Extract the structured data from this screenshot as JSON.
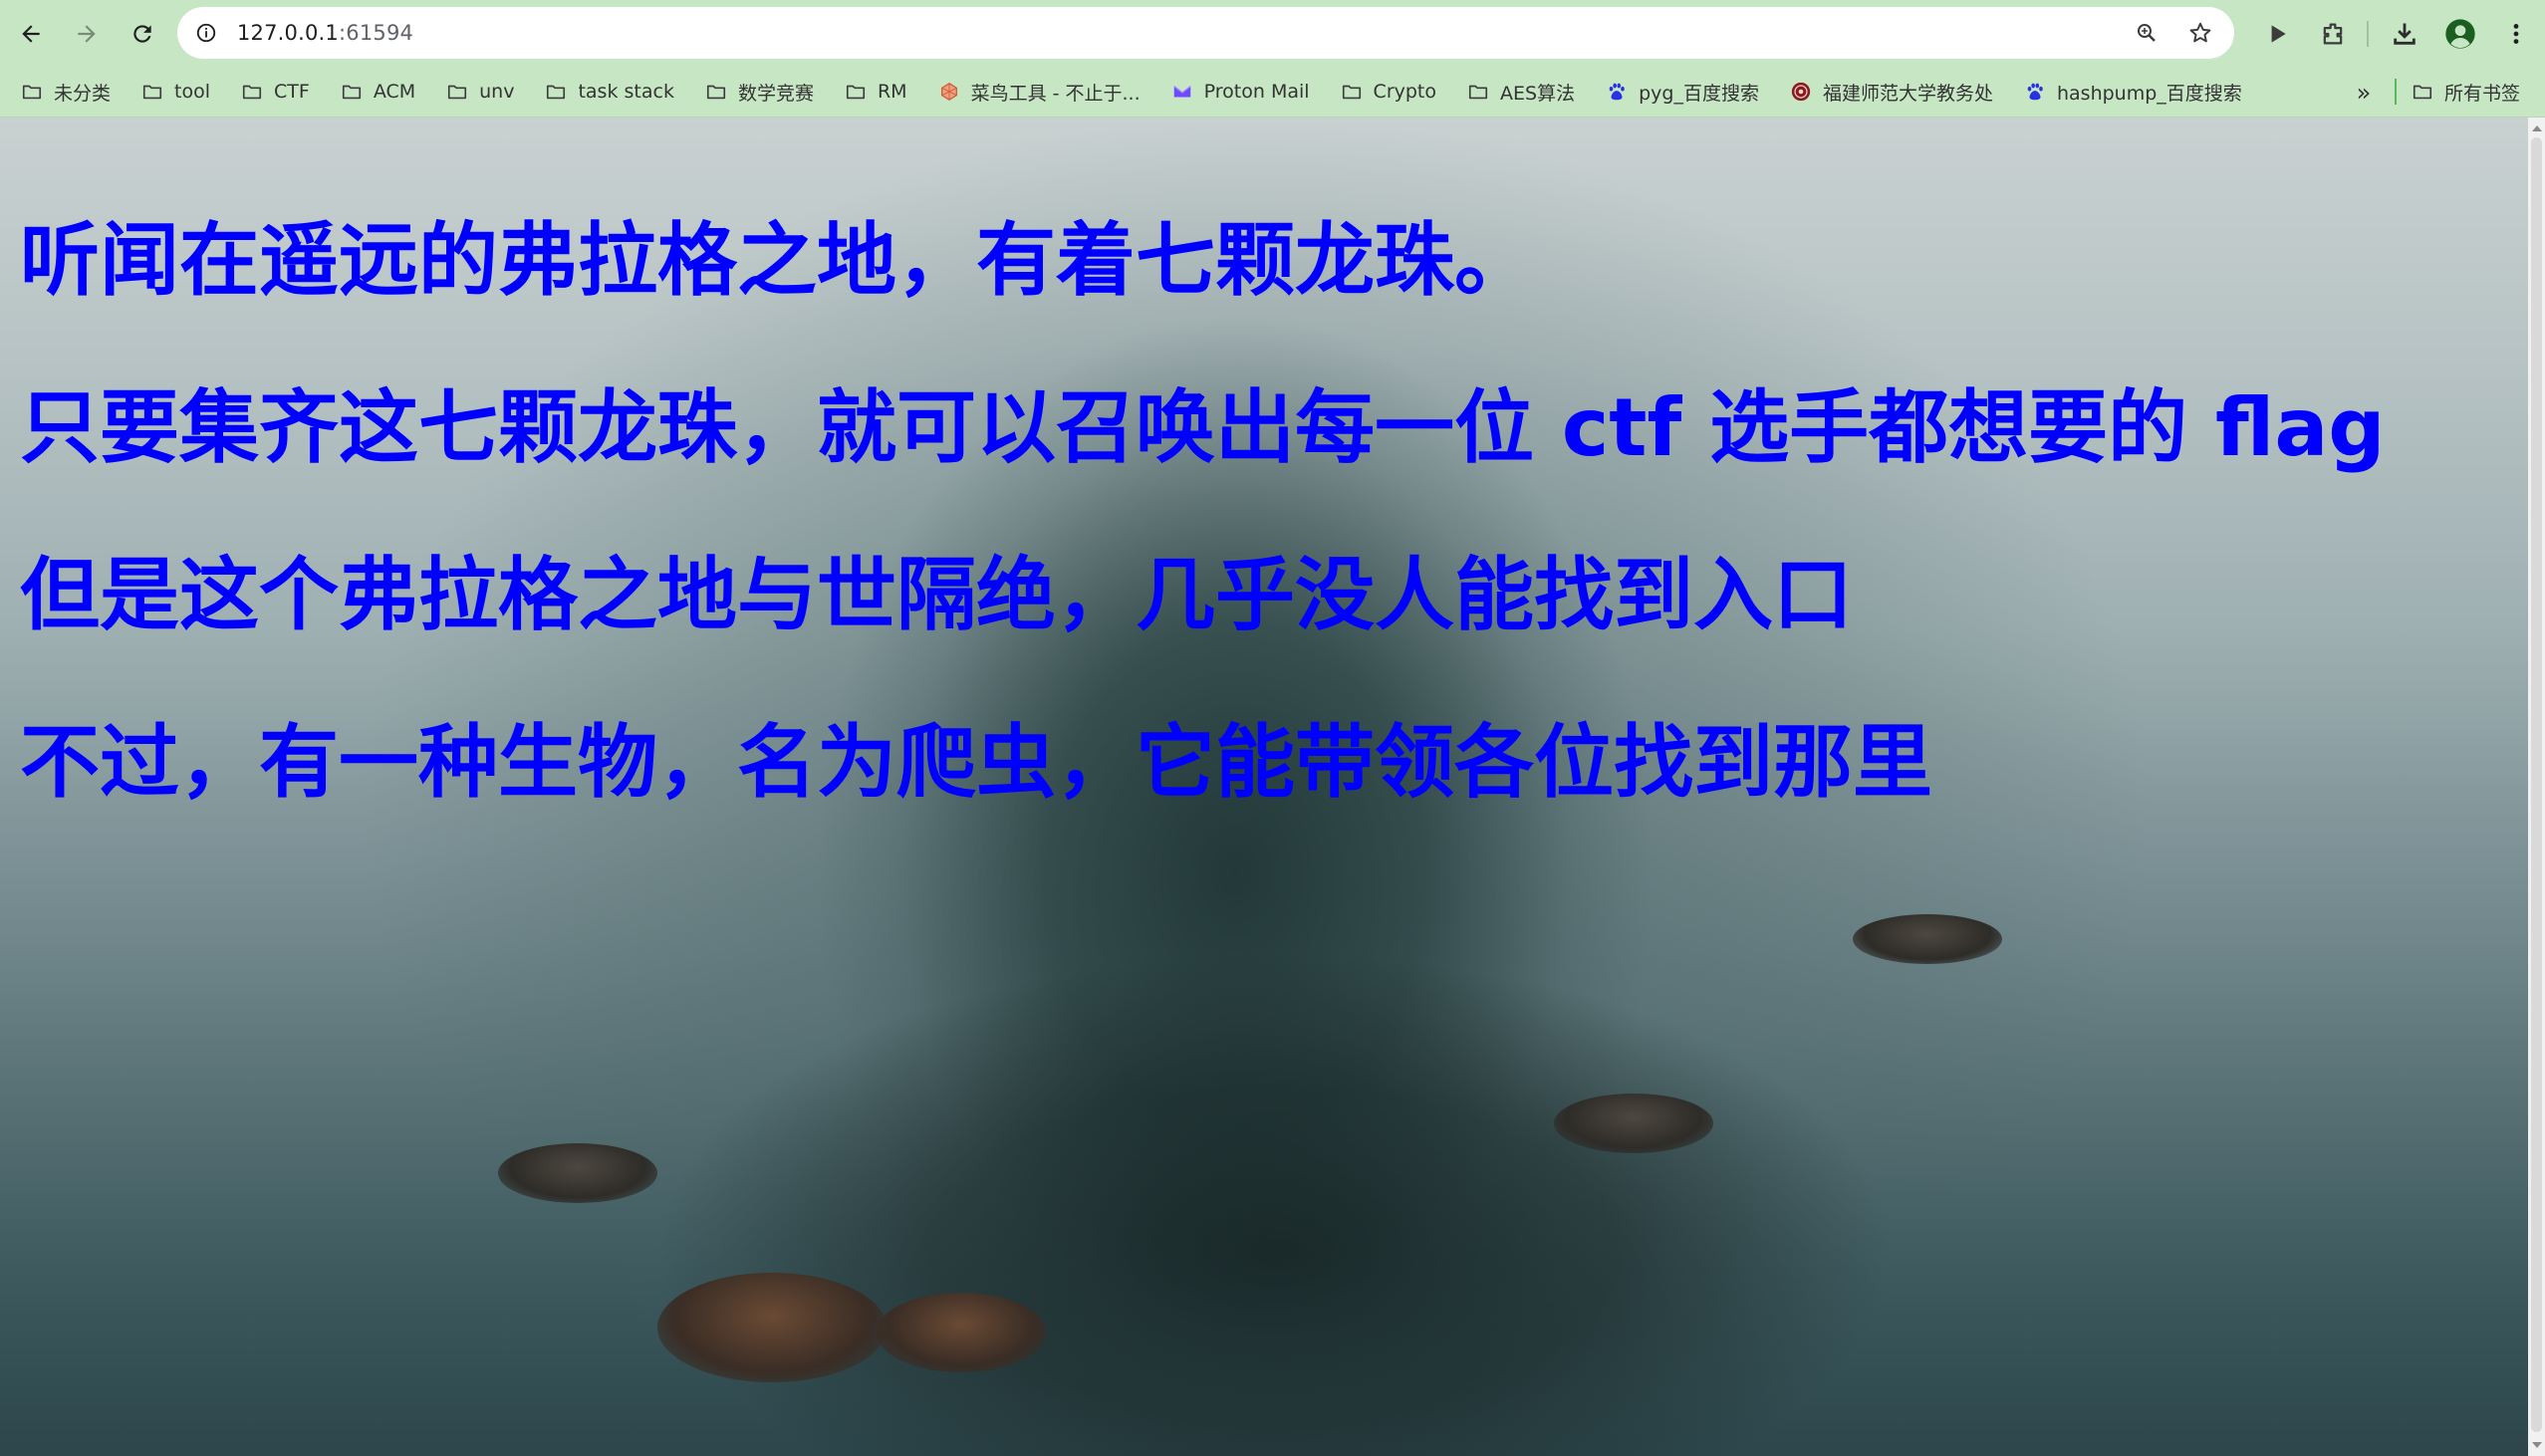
{
  "browser": {
    "url_host": "127.0.0.1",
    "url_port": ":61594",
    "nav": {
      "back_icon": "arrow-left-icon",
      "forward_icon": "arrow-right-icon",
      "reload_icon": "reload-icon"
    },
    "omnibox_actions": [
      "zoom-icon",
      "bookmark-star-icon"
    ],
    "toolbar_actions": [
      "media-play-icon",
      "extensions-icon",
      "download-icon",
      "profile-icon",
      "menu-icon"
    ],
    "colors": {
      "toolbar_bg": "#c7e7c4",
      "omnibox_bg": "#ffffff"
    }
  },
  "bookmarks": {
    "items": [
      {
        "label": "未分类",
        "icon": "folder-icon"
      },
      {
        "label": "tool",
        "icon": "folder-icon"
      },
      {
        "label": "CTF",
        "icon": "folder-icon"
      },
      {
        "label": "ACM",
        "icon": "folder-icon"
      },
      {
        "label": "unv",
        "icon": "folder-icon"
      },
      {
        "label": "task stack",
        "icon": "folder-icon"
      },
      {
        "label": "数学竞赛",
        "icon": "folder-icon"
      },
      {
        "label": "RM",
        "icon": "folder-icon"
      },
      {
        "label": "菜鸟工具 - 不止于...",
        "icon": "runoob-icon"
      },
      {
        "label": "Proton Mail",
        "icon": "proton-icon"
      },
      {
        "label": "Crypto",
        "icon": "folder-icon"
      },
      {
        "label": "AES算法",
        "icon": "folder-icon"
      },
      {
        "label": "pyg_百度搜索",
        "icon": "baidu-icon"
      },
      {
        "label": "福建师范大学教务处",
        "icon": "university-icon"
      },
      {
        "label": "hashpump_百度搜索",
        "icon": "baidu-icon"
      }
    ],
    "overflow_label": "»",
    "all_bookmarks_label": "所有书签"
  },
  "page": {
    "lines": [
      "听闻在遥远的弗拉格之地，有着七颗龙珠。",
      "只要集齐这七颗龙珠，就可以召唤出每一位 ctf 选手都想要的 flag",
      "但是这个弗拉格之地与世隔绝，几乎没人能找到入口",
      "不过，有一种生物，名为爬虫，它能带领各位找到那里"
    ],
    "text_color": "#0000ff",
    "background": "misty-island-lake-photo"
  }
}
